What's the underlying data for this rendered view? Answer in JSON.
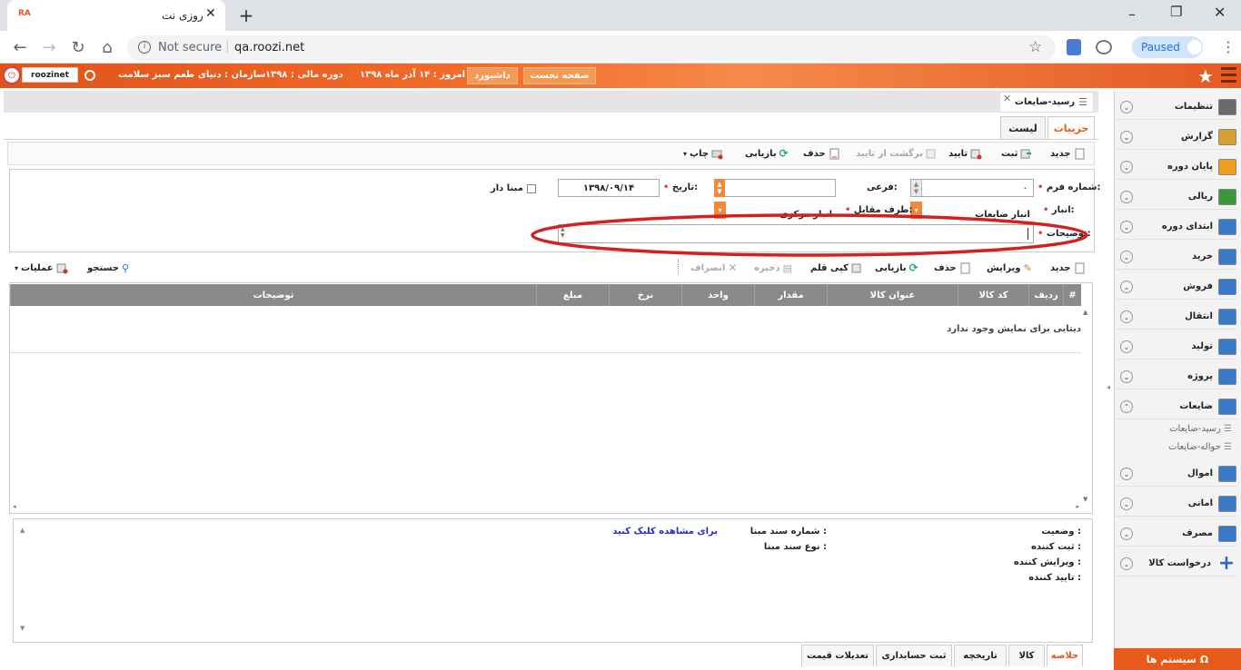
{
  "browser": {
    "tab_title": "روزی نت",
    "favicon_text": "RA",
    "security": "Not secure",
    "url": "qa.roozi.net",
    "profile_status": "Paused"
  },
  "header": {
    "user": "roozinet",
    "org": "سازمان : دنیای طعم سبز سلامت",
    "fiscal": "دوره مالی : ۱۳۹۸",
    "today": "امروز : ۱۴ آذر ماه ۱۳۹۸",
    "dashboard": "داشبورد",
    "home": "صفحه نخست"
  },
  "sidebar": {
    "items": [
      {
        "label": "تنظیمات"
      },
      {
        "label": "گزارش"
      },
      {
        "label": "پایان دوره"
      },
      {
        "label": "ریالی"
      },
      {
        "label": "ابتدای دوره"
      },
      {
        "label": "خرید"
      },
      {
        "label": "فروش"
      },
      {
        "label": "انتقال"
      },
      {
        "label": "تولید"
      },
      {
        "label": "پروژه"
      },
      {
        "label": "ضایعات"
      }
    ],
    "sub_items": [
      {
        "label": "رسید-ضایعات"
      },
      {
        "label": "حواله-ضایعات"
      }
    ],
    "items2": [
      {
        "label": "اموال"
      },
      {
        "label": "امانی"
      },
      {
        "label": "مصرف"
      },
      {
        "label": "درخواست کالا"
      }
    ],
    "systems": "سیستم ها"
  },
  "page": {
    "title": "رسید-ضایعات",
    "tabs": [
      "جزییات",
      "لیست"
    ],
    "toolbar": {
      "new": "جدید",
      "register": "ثبت",
      "approve": "تایید",
      "unapprove": "برگشت از تایید",
      "delete": "حذف",
      "refresh": "بازیابی",
      "print": "چاپ"
    },
    "form": {
      "form_no_label": "شماره فرم:",
      "form_no_value": "۰",
      "sub_label": "فرعی:",
      "date_label": "تاریخ:",
      "date_value": "۱۳۹۸/۰۹/۱۴",
      "base_label": "مبنا دار",
      "warehouse_label": "انبار:",
      "warehouse_value": "انبار ضایعات",
      "counterpart_label": "طرف مقابل:",
      "counterpart_value": "انبار مرکزی",
      "desc_label": "توضیحات:"
    },
    "grid_toolbar": {
      "new": "جدید",
      "edit": "ویرایش",
      "delete": "حذف",
      "refresh": "بازیابی",
      "copy": "کپی قلم",
      "save": "ذخیره",
      "cancel": "انصراف",
      "search": "جستجو",
      "operations": "عملیات"
    },
    "grid": {
      "columns": [
        "#",
        "ردیف",
        "کد کالا",
        "عنوان کالا",
        "مقدار",
        "واحد",
        "نرخ",
        "مبلغ",
        "توضیحات"
      ],
      "empty": "دیتایی برای نمایش وجود ندارد"
    },
    "summary": {
      "status": "وضعیت :",
      "created_by": "ثبت کننده :",
      "edited_by": "ویرایش کننده :",
      "approved_by": "تایید کننده :",
      "base_doc_no": "شماره سند مبنا :",
      "base_doc_type": "نوع سند مبنا :",
      "click_to_view": "برای مشاهده کلیک کنید"
    },
    "bottom_tabs": [
      "خلاصه",
      "کالا",
      "تاریخچه",
      "ثبت حسابداری",
      "تعدیلات قیمت"
    ]
  },
  "colors": {
    "accent": "#e8591a",
    "highlight": "#d42020",
    "grid_header": "#8a8a8a",
    "link": "#2a2ac8"
  }
}
